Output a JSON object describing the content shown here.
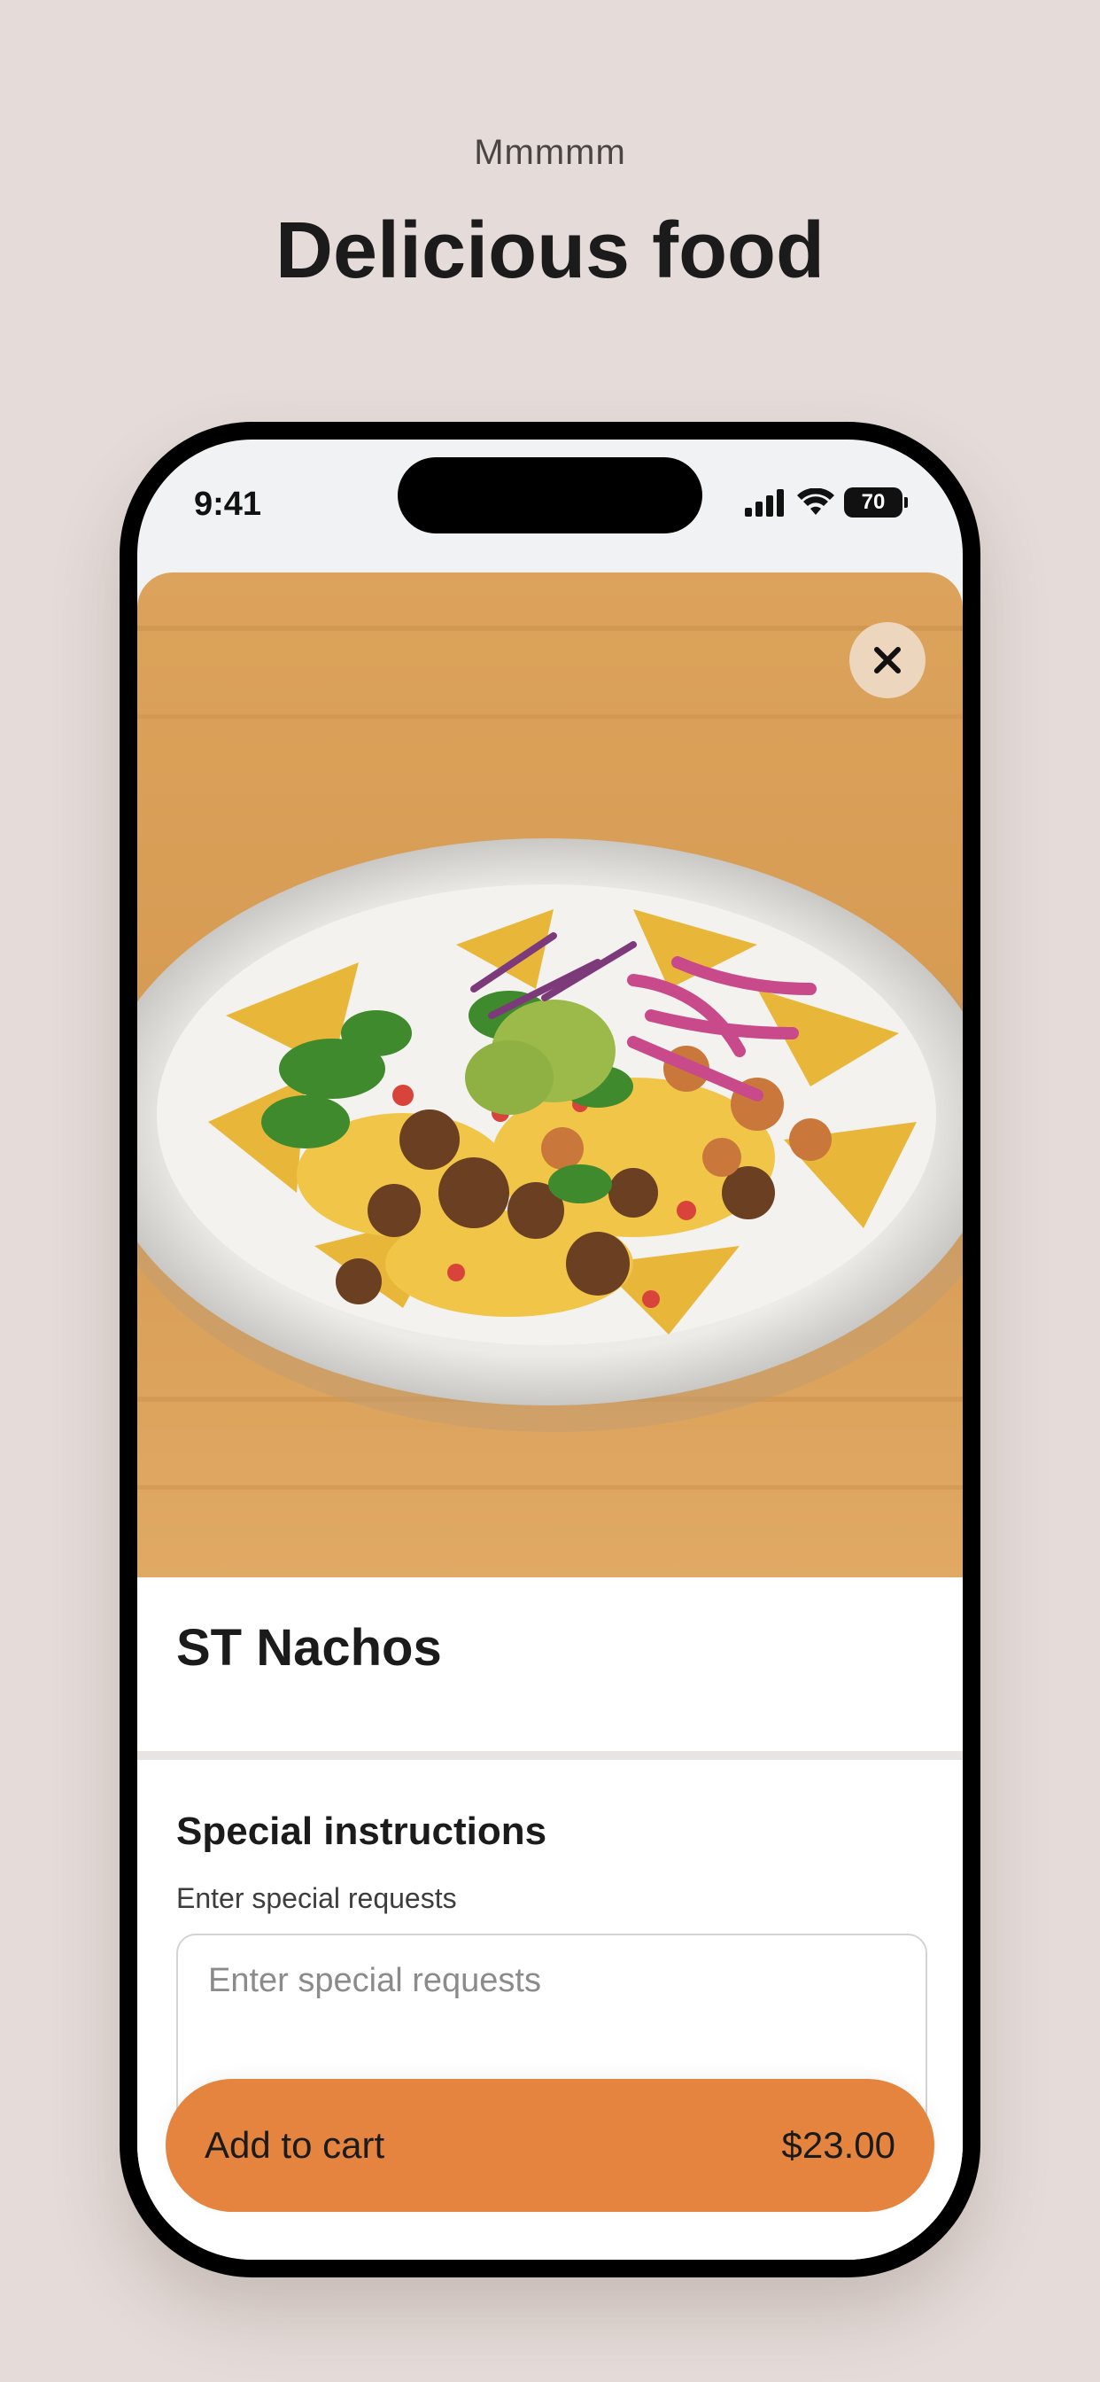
{
  "promo": {
    "kicker": "Mmmmm",
    "title": "Delicious food"
  },
  "status_bar": {
    "time": "9:41",
    "battery": "70",
    "icons": [
      "cellular-signal-icon",
      "wifi-icon",
      "battery-icon"
    ]
  },
  "item": {
    "image_description": "nachos-photo",
    "close_icon": "close-icon",
    "title": "ST Nachos"
  },
  "special_instructions": {
    "title": "Special instructions",
    "hint": "Enter special requests",
    "placeholder": "Enter special requests",
    "value": ""
  },
  "cart": {
    "label": "Add to cart",
    "price": "$23.00"
  },
  "colors": {
    "background": "#e5dcd9",
    "accent": "#e5843f",
    "close_button": "#ecd6bd"
  }
}
